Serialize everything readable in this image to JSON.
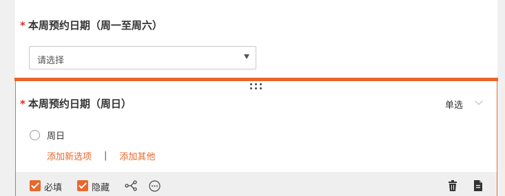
{
  "question1": {
    "required_mark": "*",
    "title": "本周预约日期（周一至周六）",
    "select_value": "请选择"
  },
  "question2": {
    "required_mark": "*",
    "title": "本周预约日期（周日）",
    "type_label": "单选",
    "options": [
      {
        "label": "周日"
      }
    ],
    "add_option_link": "添加新选项",
    "separator": "|",
    "add_other_link": "添加其他",
    "toolbar": {
      "required_label": "必填",
      "required_checked": true,
      "hidden_label": "隐藏",
      "hidden_checked": true,
      "icons": [
        "logic-icon",
        "more-icon",
        "delete-icon",
        "copy-icon"
      ]
    }
  },
  "colors": {
    "accent": "#e8672b",
    "required_mark": "#d9302c",
    "toolbar_bg": "#efefef"
  }
}
